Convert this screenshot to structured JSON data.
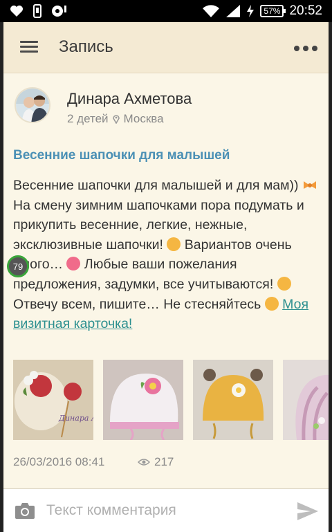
{
  "status_bar": {
    "time": "20:52",
    "battery": "57%",
    "icons": [
      "heart-icon",
      "phone-icon",
      "record-icon",
      "wifi-icon",
      "signal-icon",
      "charging-icon"
    ]
  },
  "header": {
    "title": "Запись",
    "menu_icon": "hamburger-icon",
    "more_icon": "more-dots-icon"
  },
  "post": {
    "author": {
      "name": "Динара Ахметова",
      "children": "2 детей",
      "city": "Москва"
    },
    "title": "Весенние шапочки для малышей",
    "body": {
      "p1": "Весенние шапочки для малышей и для мам))",
      "p2": "На смену зимним шапочками пора подумать и прикупить весенние, легкие, нежные, эксклюзивные шапочки!",
      "p3": "Вариантов очень много…",
      "p4": "Любые ваши пожелания предложения, задумки, все учитываются!",
      "p5": "Отвечу всем, пишите… Не стесняйтесь",
      "link": "Моя визитная карточка!"
    },
    "photo_watermark": "Динара Ахметова",
    "date": "26/03/2016 08:41",
    "views": "217"
  },
  "badge": {
    "value": "79"
  },
  "comment": {
    "placeholder": "Текст комментария",
    "camera_icon": "camera-icon",
    "send_icon": "send-icon"
  },
  "colors": {
    "header_bg": "#f4ead3",
    "page_bg": "#fbf6e7",
    "title_blue": "#4b90b5",
    "link_teal": "#2b8f8f"
  }
}
